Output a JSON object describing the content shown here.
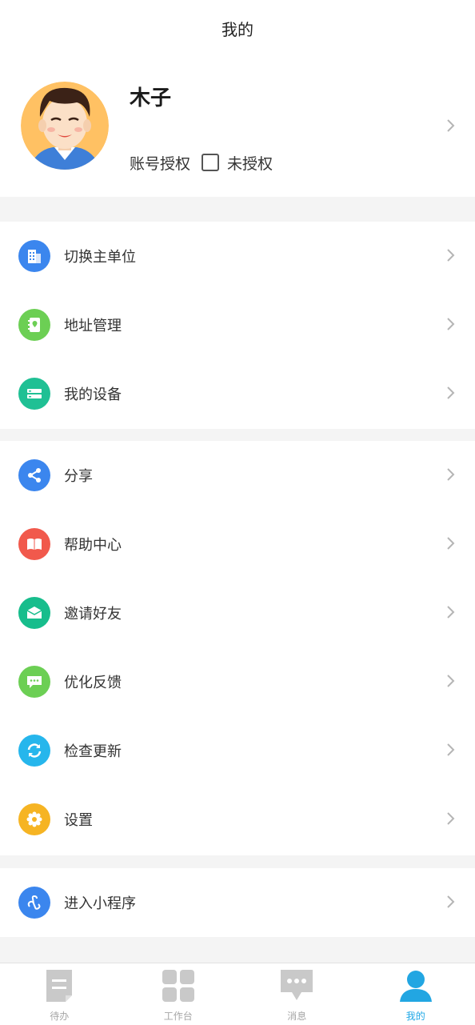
{
  "header": {
    "title": "我的"
  },
  "profile": {
    "name": "木子",
    "auth_label": "账号授权",
    "auth_status": "未授权"
  },
  "menu_groups": [
    [
      {
        "label": "切换主单位",
        "icon": "building-icon",
        "color": "#3b86ee"
      },
      {
        "label": "地址管理",
        "icon": "address-book-icon",
        "color": "#6ccf54"
      },
      {
        "label": "我的设备",
        "icon": "device-icon",
        "color": "#1fc094"
      }
    ],
    [
      {
        "label": "分享",
        "icon": "share-icon",
        "color": "#3b86ee"
      },
      {
        "label": "帮助中心",
        "icon": "book-icon",
        "color": "#f1594c"
      },
      {
        "label": "邀请好友",
        "icon": "envelope-icon",
        "color": "#17bd8c"
      },
      {
        "label": "优化反馈",
        "icon": "feedback-icon",
        "color": "#6ccf54"
      },
      {
        "label": "检查更新",
        "icon": "refresh-icon",
        "color": "#26b6ec"
      },
      {
        "label": "设置",
        "icon": "gear-icon",
        "color": "#f6b423"
      }
    ],
    [
      {
        "label": "进入小程序",
        "icon": "mini-program-icon",
        "color": "#3b86ee"
      }
    ]
  ],
  "tabs": [
    {
      "label": "待办",
      "icon": "todo-icon",
      "active": false
    },
    {
      "label": "工作台",
      "icon": "grid-icon",
      "active": false
    },
    {
      "label": "消息",
      "icon": "chat-icon",
      "active": false
    },
    {
      "label": "我的",
      "icon": "person-icon",
      "active": true
    }
  ],
  "colors": {
    "accent": "#1ea7e6",
    "inactive_tab": "#c9c9c9"
  }
}
